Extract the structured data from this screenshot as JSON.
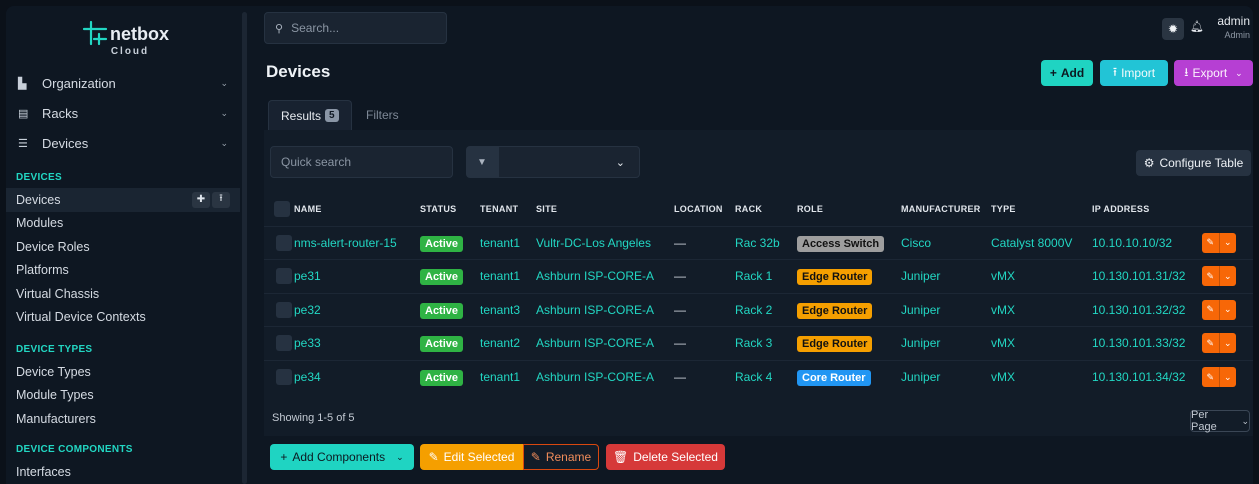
{
  "brand": {
    "name": "netbox",
    "sub": "Cloud"
  },
  "nav_top": [
    {
      "label": "Organization",
      "icon": "building-icon"
    },
    {
      "label": "Racks",
      "icon": "rack-icon"
    },
    {
      "label": "Devices",
      "icon": "server-icon"
    }
  ],
  "nav_sections": [
    {
      "heading": "DEVICES",
      "items": [
        "Devices",
        "Modules",
        "Device Roles",
        "Platforms",
        "Virtual Chassis",
        "Virtual Device Contexts"
      ]
    },
    {
      "heading": "DEVICE TYPES",
      "items": [
        "Device Types",
        "Module Types",
        "Manufacturers"
      ]
    },
    {
      "heading": "DEVICE COMPONENTS",
      "items": [
        "Interfaces"
      ]
    }
  ],
  "header": {
    "search_placeholder": "Search...",
    "user": "admin",
    "role": "Admin"
  },
  "page": {
    "title": "Devices",
    "add": "Add",
    "import": "Import",
    "export": "Export",
    "tab_results": "Results",
    "results_count": "5",
    "tab_filters": "Filters",
    "quick_search": "Quick search",
    "configure_table": "Configure Table",
    "showing": "Showing 1-5 of 5",
    "per_page": "Per Page"
  },
  "table": {
    "columns": [
      "NAME",
      "STATUS",
      "TENANT",
      "SITE",
      "LOCATION",
      "RACK",
      "ROLE",
      "MANUFACTURER",
      "TYPE",
      "IP ADDRESS"
    ],
    "rows": [
      {
        "name": "nms-alert-router-15",
        "status": "Active",
        "tenant": "tenant1",
        "site": "Vultr-DC-Los Angeles",
        "location": "—",
        "rack": "Rac 32b",
        "role": "Access Switch",
        "role_color": "#9e9e9e",
        "role_text": "#111111",
        "manufacturer": "Cisco",
        "type": "Catalyst 8000V",
        "ip": "10.10.10.10/32"
      },
      {
        "name": "pe31",
        "status": "Active",
        "tenant": "tenant1",
        "site": "Ashburn ISP-CORE-A",
        "location": "—",
        "rack": "Rack 1",
        "role": "Edge Router",
        "role_color": "#f59f00",
        "role_text": "#111111",
        "manufacturer": "Juniper",
        "type": "vMX",
        "ip": "10.130.101.31/32"
      },
      {
        "name": "pe32",
        "status": "Active",
        "tenant": "tenant3",
        "site": "Ashburn ISP-CORE-A",
        "location": "—",
        "rack": "Rack 2",
        "role": "Edge Router",
        "role_color": "#f59f00",
        "role_text": "#111111",
        "manufacturer": "Juniper",
        "type": "vMX",
        "ip": "10.130.101.32/32"
      },
      {
        "name": "pe33",
        "status": "Active",
        "tenant": "tenant2",
        "site": "Ashburn ISP-CORE-A",
        "location": "—",
        "rack": "Rack 3",
        "role": "Edge Router",
        "role_color": "#f59f00",
        "role_text": "#111111",
        "manufacturer": "Juniper",
        "type": "vMX",
        "ip": "10.130.101.33/32"
      },
      {
        "name": "pe34",
        "status": "Active",
        "tenant": "tenant1",
        "site": "Ashburn ISP-CORE-A",
        "location": "—",
        "rack": "Rack 4",
        "role": "Core Router",
        "role_color": "#2196f3",
        "role_text": "#ffffff",
        "manufacturer": "Juniper",
        "type": "vMX",
        "ip": "10.130.101.34/32"
      }
    ]
  },
  "bulk": {
    "add_components": "Add Components",
    "edit_selected": "Edit Selected",
    "rename": "Rename",
    "delete_selected": "Delete Selected"
  },
  "colors": {
    "accent": "#22d7c3",
    "status_active": "#2fb344",
    "export": "#b63fd3",
    "edit": "#f76707",
    "delete": "#d63939"
  }
}
